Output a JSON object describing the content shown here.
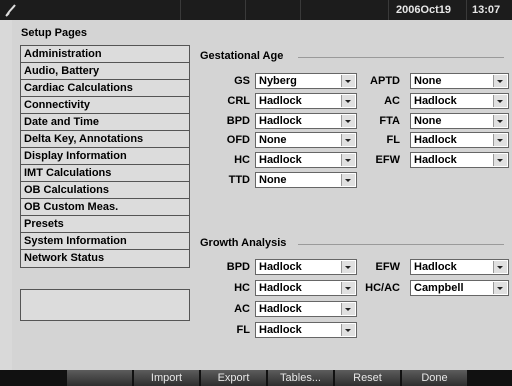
{
  "topbar": {
    "date": "2006Oct19",
    "time": "13:07"
  },
  "setup": {
    "title": "Setup Pages",
    "menu": [
      "Administration",
      "Audio, Battery",
      "Cardiac Calculations",
      "Connectivity",
      "Date and Time",
      "Delta Key, Annotations",
      "Display Information",
      "IMT Calculations",
      "OB Calculations",
      "OB Custom Meas.",
      "Presets",
      "System Information",
      "Network Status"
    ]
  },
  "gestational": {
    "title": "Gestational Age",
    "left": [
      {
        "label": "GS",
        "value": "Nyberg"
      },
      {
        "label": "CRL",
        "value": "Hadlock"
      },
      {
        "label": "BPD",
        "value": "Hadlock"
      },
      {
        "label": "OFD",
        "value": "None"
      },
      {
        "label": "HC",
        "value": "Hadlock"
      },
      {
        "label": "TTD",
        "value": "None"
      }
    ],
    "right": [
      {
        "label": "APTD",
        "value": "None"
      },
      {
        "label": "AC",
        "value": "Hadlock"
      },
      {
        "label": "FTA",
        "value": "None"
      },
      {
        "label": "FL",
        "value": "Hadlock"
      },
      {
        "label": "EFW",
        "value": "Hadlock"
      }
    ]
  },
  "growth": {
    "title": "Growth Analysis",
    "left": [
      {
        "label": "BPD",
        "value": "Hadlock"
      },
      {
        "label": "HC",
        "value": "Hadlock"
      },
      {
        "label": "AC",
        "value": "Hadlock"
      },
      {
        "label": "FL",
        "value": "Hadlock"
      }
    ],
    "right": [
      {
        "label": "EFW",
        "value": "Hadlock"
      },
      {
        "label": "HC/AC",
        "value": "Campbell"
      }
    ]
  },
  "softkeys": [
    "",
    "Import",
    "Export",
    "Tables...",
    "Reset",
    "Done"
  ]
}
